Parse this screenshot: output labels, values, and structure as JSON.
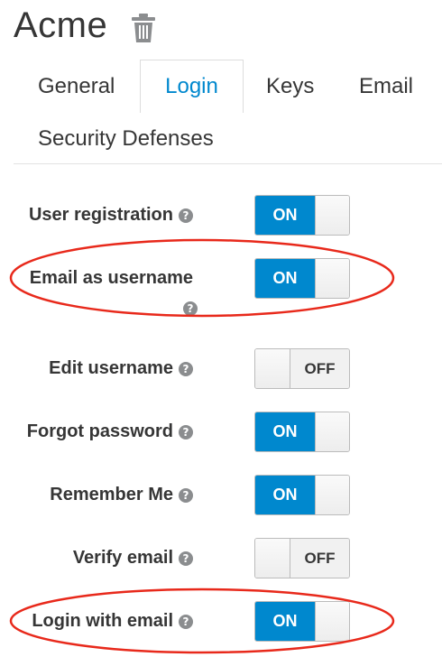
{
  "realm": {
    "title": "Acme",
    "delete_icon": "trash-icon"
  },
  "tabs": [
    {
      "label": "General",
      "active": false
    },
    {
      "label": "Login",
      "active": true
    },
    {
      "label": "Keys",
      "active": false
    },
    {
      "label": "Email",
      "active": false
    },
    {
      "label": "Security Defenses",
      "active": false
    }
  ],
  "settings": [
    {
      "label": "User registration",
      "state": "ON",
      "highlighted": false
    },
    {
      "label": "Email as username",
      "state": "ON",
      "highlighted": true
    },
    {
      "label": "Edit username",
      "state": "OFF",
      "highlighted": false
    },
    {
      "label": "Forgot password",
      "state": "ON",
      "highlighted": false
    },
    {
      "label": "Remember Me",
      "state": "ON",
      "highlighted": false
    },
    {
      "label": "Verify email",
      "state": "OFF",
      "highlighted": false
    },
    {
      "label": "Login with email",
      "state": "ON",
      "highlighted": true
    }
  ],
  "help_icon_glyph": "?",
  "colors": {
    "accent": "#0088ce",
    "highlight": "#e8291b",
    "text": "#363636"
  }
}
